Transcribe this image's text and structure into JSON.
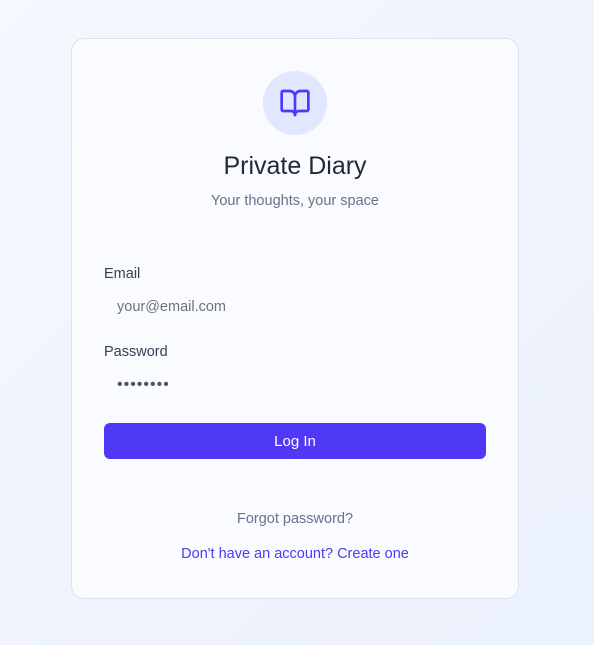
{
  "app": {
    "title": "Private Diary",
    "subtitle": "Your thoughts, your space",
    "logo_icon": "open-book-icon"
  },
  "form": {
    "email_label": "Email",
    "email_placeholder": "your@email.com",
    "email_value": "",
    "password_label": "Password",
    "password_value": "password",
    "login_label": "Log In"
  },
  "links": {
    "forgot_password": "Forgot password?",
    "create_account": "Don't have an account? Create one"
  },
  "colors": {
    "accent": "#4f39f6",
    "logo_bg": "#e0e7ff"
  }
}
